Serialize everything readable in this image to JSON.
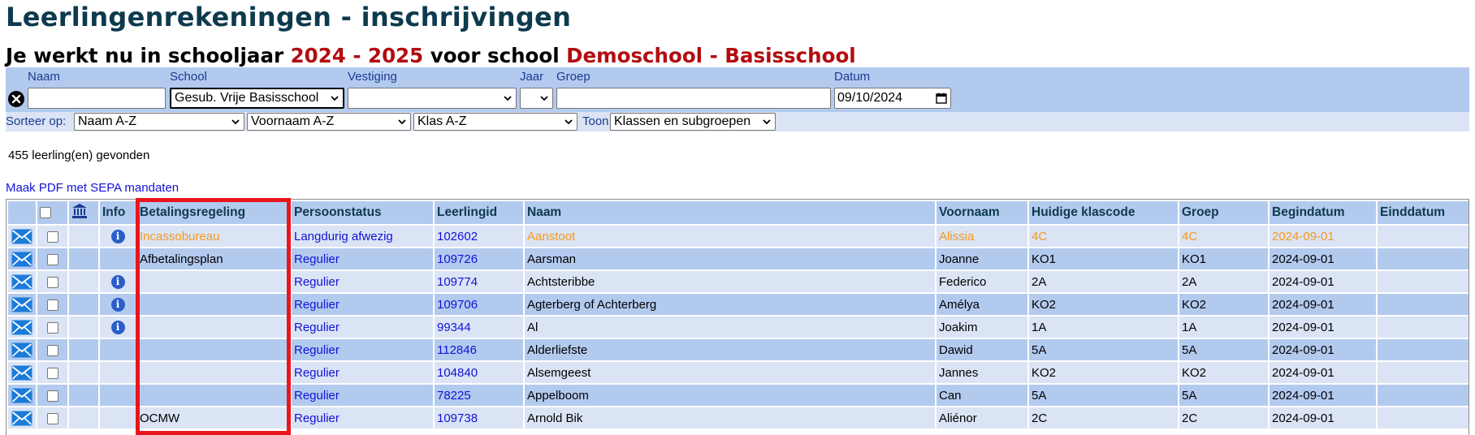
{
  "page": {
    "title": "Leerlingenrekeningen - inschrijvingen",
    "context_prefix": "Je werkt nu in schooljaar ",
    "school_year": "2024 - 2025",
    "context_mid": " voor school ",
    "school_name": "Demoschool - Basisschool"
  },
  "colors": {
    "title": "#0d3a4d",
    "context_highlight": "#b30c10",
    "filter_bar": "#b3caef",
    "sort_bar": "#dbe4f5",
    "link": "#1212d6",
    "row_highlight": "#f59a1e",
    "callout_border": "#e8161c"
  },
  "filters": {
    "naam_label": "Naam",
    "naam_value": "",
    "school_label": "School",
    "school_value": "Gesub. Vrije Basisschool",
    "vestiging_label": "Vestiging",
    "vestiging_value": "",
    "jaar_label": "Jaar",
    "jaar_value": "",
    "groep_label": "Groep",
    "groep_value": "",
    "datum_label": "Datum",
    "datum_value": "09/10/2024",
    "clear_icon": "close-circle-icon",
    "calendar_icon": "calendar-icon"
  },
  "sort": {
    "label": "Sorteer op:",
    "sort1": "Naam A-Z",
    "sort2": "Voornaam A-Z",
    "sort3": "Klas A-Z",
    "toon_label": "Toon:",
    "toon_value": "Klassen en subgroepen"
  },
  "results": {
    "count_text": "455 leerling(en) gevonden",
    "pdf_link": "Maak PDF met SEPA mandaten"
  },
  "table": {
    "headers": {
      "bank_icon": "bank-icon",
      "info": "Info",
      "betalingsregeling": "Betalingsregeling",
      "persoonstatus": "Persoonstatus",
      "leerlingid": "Leerlingid",
      "naam": "Naam",
      "voornaam": "Voornaam",
      "klascode": "Huidige klascode",
      "groep": "Groep",
      "begindatum": "Begindatum",
      "einddatum": "Einddatum"
    },
    "rows": [
      {
        "info": true,
        "betalingsregeling": "Incassobureau",
        "persoonstatus": "Langdurig afwezig",
        "leerlingid": "102602",
        "naam": "Aanstoot",
        "voornaam": "Alissia",
        "klascode": "4C",
        "groep": "4C",
        "begindatum": "2024-09-01",
        "einddatum": "",
        "highlight": true
      },
      {
        "info": false,
        "betalingsregeling": "Afbetalingsplan",
        "persoonstatus": "Regulier",
        "leerlingid": "109726",
        "naam": "Aarsman",
        "voornaam": "Joanne",
        "klascode": "KO1",
        "groep": "KO1",
        "begindatum": "2024-09-01",
        "einddatum": ""
      },
      {
        "info": true,
        "betalingsregeling": "",
        "persoonstatus": "Regulier",
        "leerlingid": "109774",
        "naam": "Achtsteribbe",
        "voornaam": "Federico",
        "klascode": "2A",
        "groep": "2A",
        "begindatum": "2024-09-01",
        "einddatum": ""
      },
      {
        "info": true,
        "betalingsregeling": "",
        "persoonstatus": "Regulier",
        "leerlingid": "109706",
        "naam": "Agterberg of Achterberg",
        "voornaam": "Amélya",
        "klascode": "KO2",
        "groep": "KO2",
        "begindatum": "2024-09-01",
        "einddatum": ""
      },
      {
        "info": true,
        "betalingsregeling": "",
        "persoonstatus": "Regulier",
        "leerlingid": "99344",
        "naam": "Al",
        "voornaam": "Joakim",
        "klascode": "1A",
        "groep": "1A",
        "begindatum": "2024-09-01",
        "einddatum": ""
      },
      {
        "info": false,
        "betalingsregeling": "",
        "persoonstatus": "Regulier",
        "leerlingid": "112846",
        "naam": "Alderliefste",
        "voornaam": "Dawid",
        "klascode": "5A",
        "groep": "5A",
        "begindatum": "2024-09-01",
        "einddatum": ""
      },
      {
        "info": false,
        "betalingsregeling": "",
        "persoonstatus": "Regulier",
        "leerlingid": "104840",
        "naam": "Alsemgeest",
        "voornaam": "Jannes",
        "klascode": "KO2",
        "groep": "KO2",
        "begindatum": "2024-09-01",
        "einddatum": ""
      },
      {
        "info": false,
        "betalingsregeling": "",
        "persoonstatus": "Regulier",
        "leerlingid": "78225",
        "naam": "Appelboom",
        "voornaam": "Can",
        "klascode": "5A",
        "groep": "5A",
        "begindatum": "2024-09-01",
        "einddatum": ""
      },
      {
        "info": false,
        "betalingsregeling": "OCMW",
        "persoonstatus": "Regulier",
        "leerlingid": "109738",
        "naam": "Arnold Bik",
        "voornaam": "Aliénor",
        "klascode": "2C",
        "groep": "2C",
        "begindatum": "2024-09-01",
        "einddatum": ""
      }
    ]
  }
}
